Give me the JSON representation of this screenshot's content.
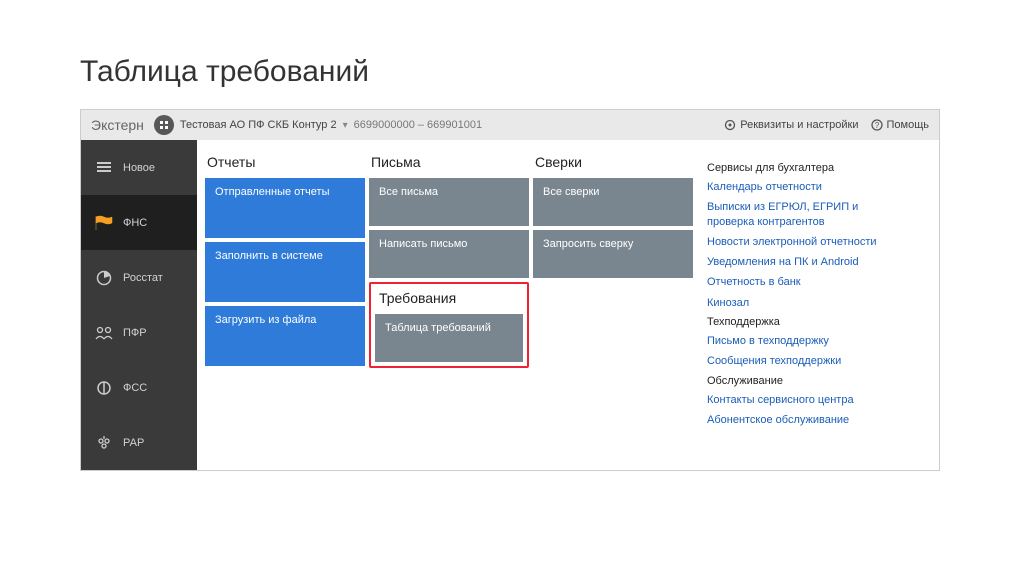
{
  "page_title": "Таблица требований",
  "topbar": {
    "brand": "Экстерн",
    "org_name": "Тестовая АО ПФ СКБ Контур 2",
    "org_id": "6699000000 – 669901001",
    "settings_label": "Реквизиты и настройки",
    "help_label": "Помощь"
  },
  "sidebar": {
    "items": [
      {
        "label": "Новое",
        "icon": "stack"
      },
      {
        "label": "ФНС",
        "icon": "flag",
        "active": true
      },
      {
        "label": "Росстат",
        "icon": "pie"
      },
      {
        "label": "ПФР",
        "icon": "people"
      },
      {
        "label": "ФСС",
        "icon": "shield"
      },
      {
        "label": "РАР",
        "icon": "grapes"
      }
    ]
  },
  "columns": {
    "reports": {
      "title": "Отчеты",
      "tiles": [
        {
          "label": "Отправленные отчеты",
          "style": "blue",
          "tall": true
        },
        {
          "label": "Заполнить в системе",
          "style": "blue",
          "tall": true
        },
        {
          "label": "Загрузить из файла",
          "style": "blue",
          "tall": true
        }
      ]
    },
    "letters": {
      "title": "Письма",
      "tiles": [
        {
          "label": "Все письма"
        },
        {
          "label": "Написать письмо"
        }
      ],
      "requirements_title": "Требования",
      "requirements_tile": "Таблица требований"
    },
    "reconcile": {
      "title": "Сверки",
      "tiles": [
        {
          "label": "Все сверки"
        },
        {
          "label": "Запросить сверку"
        }
      ]
    }
  },
  "rightpanel": {
    "section1_title": "Сервисы для бухгалтера",
    "section1_links": [
      "Календарь отчетности",
      "Выписки из ЕГРЮЛ, ЕГРИП и проверка контрагентов",
      "Новости электронной отчетности",
      "Уведомления на ПК и Android",
      "Отчетность в банк",
      "Кинозал"
    ],
    "section2_title": "Техподдержка",
    "section2_links": [
      "Письмо в техподдержку",
      "Сообщения техподдержки"
    ],
    "section3_title": "Обслуживание",
    "section3_links": [
      "Контакты сервисного центра",
      "Абонентское обслуживание"
    ]
  }
}
